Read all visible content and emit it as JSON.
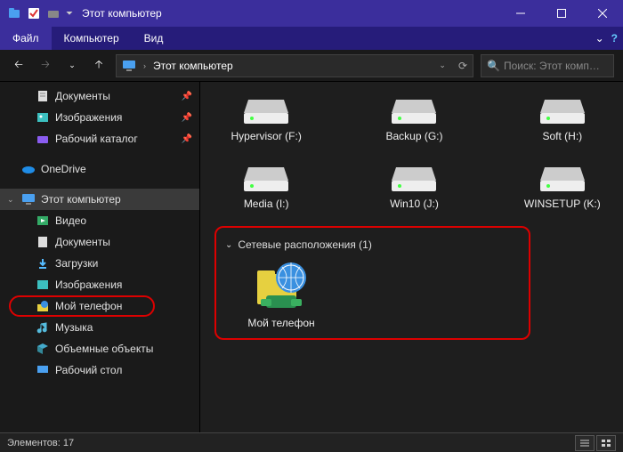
{
  "titlebar": {
    "title": "Этот компьютер"
  },
  "menus": {
    "file": "Файл",
    "computer": "Компьютер",
    "view": "Вид"
  },
  "address": {
    "crumb": "Этот компьютер"
  },
  "search": {
    "placeholder": "Поиск: Этот комп…"
  },
  "sidebar": {
    "items": [
      {
        "label": "Документы",
        "pin": true
      },
      {
        "label": "Изображения",
        "pin": true
      },
      {
        "label": "Рабочий каталог",
        "pin": true
      }
    ],
    "onedrive": "OneDrive",
    "thispc": "Этот компьютер",
    "subs": [
      {
        "label": "Видео"
      },
      {
        "label": "Документы"
      },
      {
        "label": "Загрузки"
      },
      {
        "label": "Изображения"
      },
      {
        "label": "Мой телефон",
        "hl": true
      },
      {
        "label": "Музыка"
      },
      {
        "label": "Объемные объекты"
      },
      {
        "label": "Рабочий стол"
      }
    ]
  },
  "drives": {
    "row1": [
      {
        "label": "Hypervisor (F:)"
      },
      {
        "label": "Backup (G:)"
      },
      {
        "label": "Soft (H:)"
      }
    ],
    "row2": [
      {
        "label": "Media (I:)"
      },
      {
        "label": "Win10 (J:)"
      },
      {
        "label": "WINSETUP (K:)"
      }
    ]
  },
  "section": {
    "header": "Сетевые расположения (1)"
  },
  "netloc": {
    "label": "Мой телефон"
  },
  "status": {
    "items": "Элементов: 17"
  }
}
